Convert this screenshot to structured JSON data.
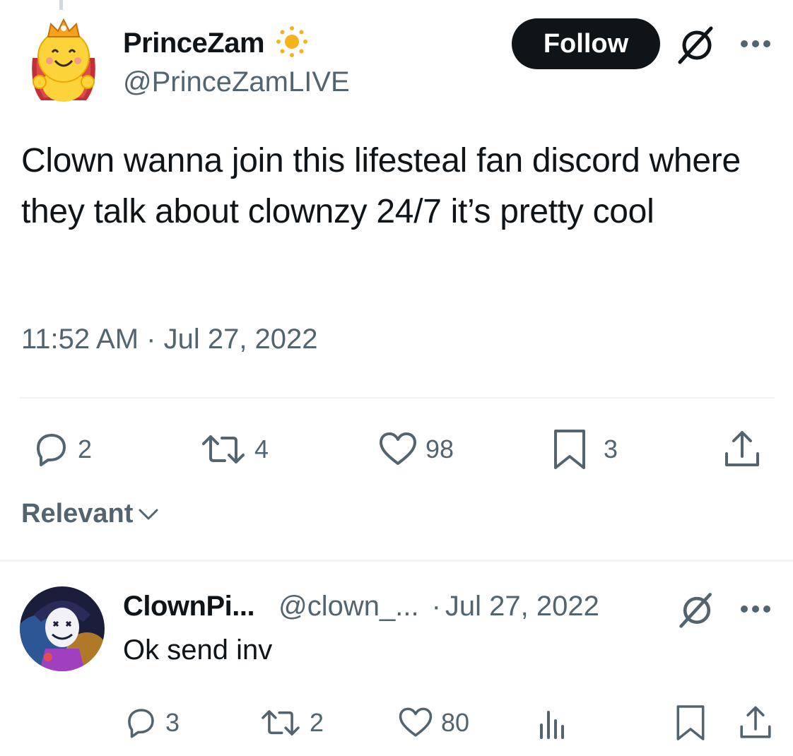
{
  "tweet": {
    "author": {
      "display_name": "PrinceZam",
      "badge_icon": "sun-emoji-icon",
      "handle": "@PrinceZamLIVE"
    },
    "follow_label": "Follow",
    "text": "Clown wanna join this lifesteal fan discord where they talk about clownzy 24/7 it’s pretty cool",
    "timestamp": "11:52 AM · Jul 27, 2022",
    "stats": {
      "replies": "2",
      "reposts": "4",
      "likes": "98",
      "bookmarks": "3"
    }
  },
  "sort": {
    "label": "Relevant"
  },
  "reply": {
    "author": {
      "display_name": "ClownPi...",
      "handle": "@clown_..."
    },
    "separator": "·",
    "date": "Jul 27, 2022",
    "text": "Ok send inv",
    "stats": {
      "replies": "3",
      "reposts": "2",
      "likes": "80"
    }
  },
  "colors": {
    "text_primary": "#0f1419",
    "text_secondary": "#536471",
    "divider": "#eff3f4",
    "follow_bg": "#0f1419",
    "avatar_yellow": "#fdd33a",
    "crown_red": "#c0303a"
  }
}
